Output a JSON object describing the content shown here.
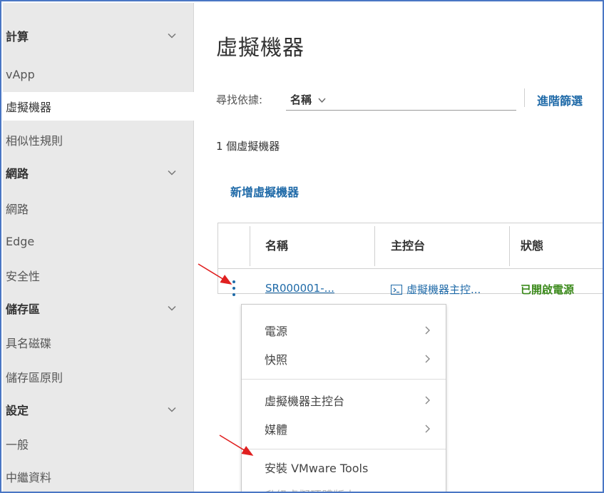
{
  "sidebar": {
    "items": [
      {
        "label": "計算",
        "type": "header",
        "expandable": true
      },
      {
        "label": "vApp",
        "type": "item"
      },
      {
        "label": "虛擬機器",
        "type": "item",
        "active": true
      },
      {
        "label": "相似性規則",
        "type": "item"
      },
      {
        "label": "網路",
        "type": "header",
        "expandable": true
      },
      {
        "label": "網路",
        "type": "item"
      },
      {
        "label": "Edge",
        "type": "item"
      },
      {
        "label": "安全性",
        "type": "item"
      },
      {
        "label": "儲存區",
        "type": "header",
        "expandable": true
      },
      {
        "label": "具名磁碟",
        "type": "item"
      },
      {
        "label": "儲存區原則",
        "type": "item"
      },
      {
        "label": "設定",
        "type": "header",
        "expandable": true
      },
      {
        "label": "一般",
        "type": "item"
      },
      {
        "label": "中繼資料",
        "type": "item"
      }
    ]
  },
  "main": {
    "title": "虛擬機器",
    "search": {
      "label": "尋找依據:",
      "selected": "名稱"
    },
    "advanced_filter": "進階篩選",
    "count_text": "1 個虛擬機器",
    "add_vm": "新增虛擬機器",
    "columns": [
      "名稱",
      "主控台",
      "狀態"
    ],
    "rows": [
      {
        "name": "SR000001-...",
        "console": "虛擬機器主控...",
        "status": "已開啟電源"
      }
    ]
  },
  "context_menu": {
    "items": [
      {
        "label": "電源",
        "submenu": true
      },
      {
        "label": "快照",
        "submenu": true
      },
      {
        "label": "虛擬機器主控台",
        "submenu": true
      },
      {
        "label": "媒體",
        "submenu": true
      },
      {
        "label": "安裝 VMware Tools",
        "submenu": false
      },
      {
        "label": "升級虛擬硬體版本",
        "submenu": false,
        "disabled": true
      }
    ]
  },
  "colors": {
    "link": "#1f6aa8",
    "status_on": "#3c8a1c",
    "annotation_arrow": "#e02020",
    "frame_border": "#4a76c4"
  }
}
